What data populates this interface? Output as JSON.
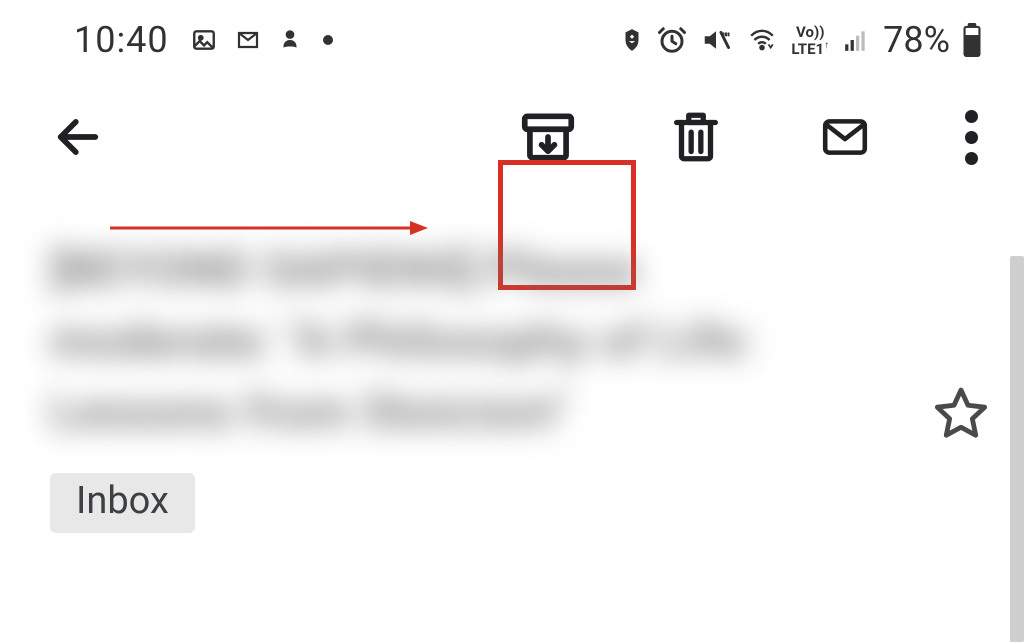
{
  "statusbar": {
    "time": "10:40",
    "battery_pct": "78%",
    "lte_label": "Vo))\nLTE1"
  },
  "toolbar": {},
  "email": {
    "subject": "[BEYOND SAPIENS] Please moderate: \"A Philosophy of Life: Lessons from Stoicism\"",
    "label": "Inbox"
  },
  "annotation": {
    "highlight_target": "archive-button"
  }
}
